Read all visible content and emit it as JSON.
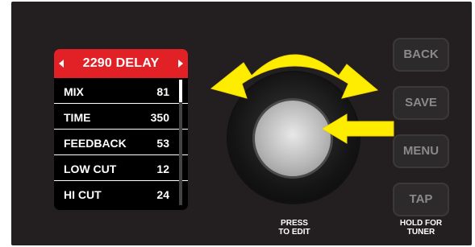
{
  "colors": {
    "panel": "#231f20",
    "header_red": "#e22126",
    "arrow_yellow": "#ffed00",
    "button_text": "#8a8a8a"
  },
  "display": {
    "title": "2290 DELAY",
    "rows": [
      {
        "label": "MIX",
        "value": "81"
      },
      {
        "label": "TIME",
        "value": "350"
      },
      {
        "label": "FEEDBACK",
        "value": "53"
      },
      {
        "label": "LOW CUT",
        "value": "12"
      },
      {
        "label": "HI CUT",
        "value": "24"
      }
    ]
  },
  "knob": {
    "caption_line1": "PRESS",
    "caption_line2": "TO EDIT"
  },
  "buttons": {
    "back": "BACK",
    "save": "SAVE",
    "menu": "MENU",
    "tap": "TAP",
    "tap_caption_line1": "HOLD FOR",
    "tap_caption_line2": "TUNER"
  },
  "icons": {
    "rotate": "double-headed-curved-arrow-icon",
    "press": "left-arrow-icon"
  }
}
